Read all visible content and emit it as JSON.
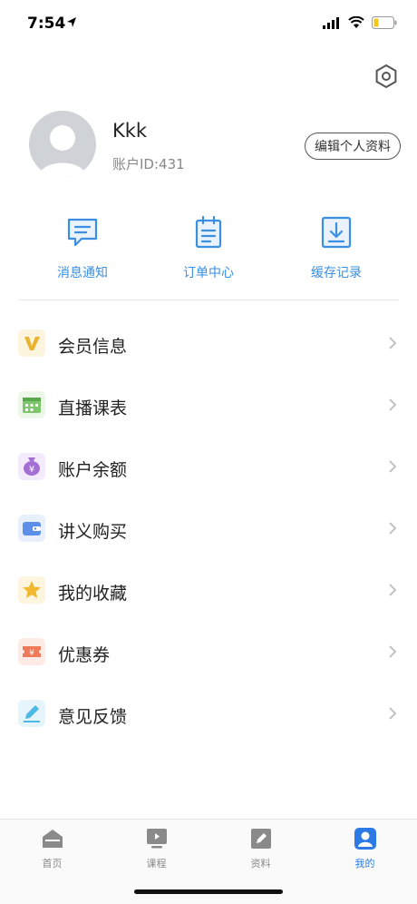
{
  "status": {
    "time": "7:54"
  },
  "profile": {
    "name": "Kkk",
    "account_id": "账户ID:431",
    "edit_label": "编辑个人资料"
  },
  "quick_actions": [
    {
      "label": "消息通知",
      "icon": "message-icon"
    },
    {
      "label": "订单中心",
      "icon": "clipboard-icon"
    },
    {
      "label": "缓存记录",
      "icon": "download-icon"
    }
  ],
  "menu": [
    {
      "label": "会员信息",
      "icon": "vip-icon",
      "color": "#e8b330"
    },
    {
      "label": "直播课表",
      "icon": "calendar-icon",
      "color": "#7cc66b"
    },
    {
      "label": "账户余额",
      "icon": "money-bag-icon",
      "color": "#a46fd4"
    },
    {
      "label": "讲义购买",
      "icon": "wallet-icon",
      "color": "#5b8fe8"
    },
    {
      "label": "我的收藏",
      "icon": "star-icon",
      "color": "#f1b92e"
    },
    {
      "label": "优惠券",
      "icon": "coupon-icon",
      "color": "#ef7a5a"
    },
    {
      "label": "意见反馈",
      "icon": "pencil-icon",
      "color": "#4fb9e6"
    }
  ],
  "tabs": [
    {
      "label": "首页",
      "icon": "home-icon"
    },
    {
      "label": "课程",
      "icon": "course-icon"
    },
    {
      "label": "资料",
      "icon": "materials-icon"
    },
    {
      "label": "我的",
      "icon": "profile-icon",
      "active": true
    }
  ],
  "colors": {
    "accent": "#2c7be5",
    "quick_accent": "#3a8fe0"
  }
}
